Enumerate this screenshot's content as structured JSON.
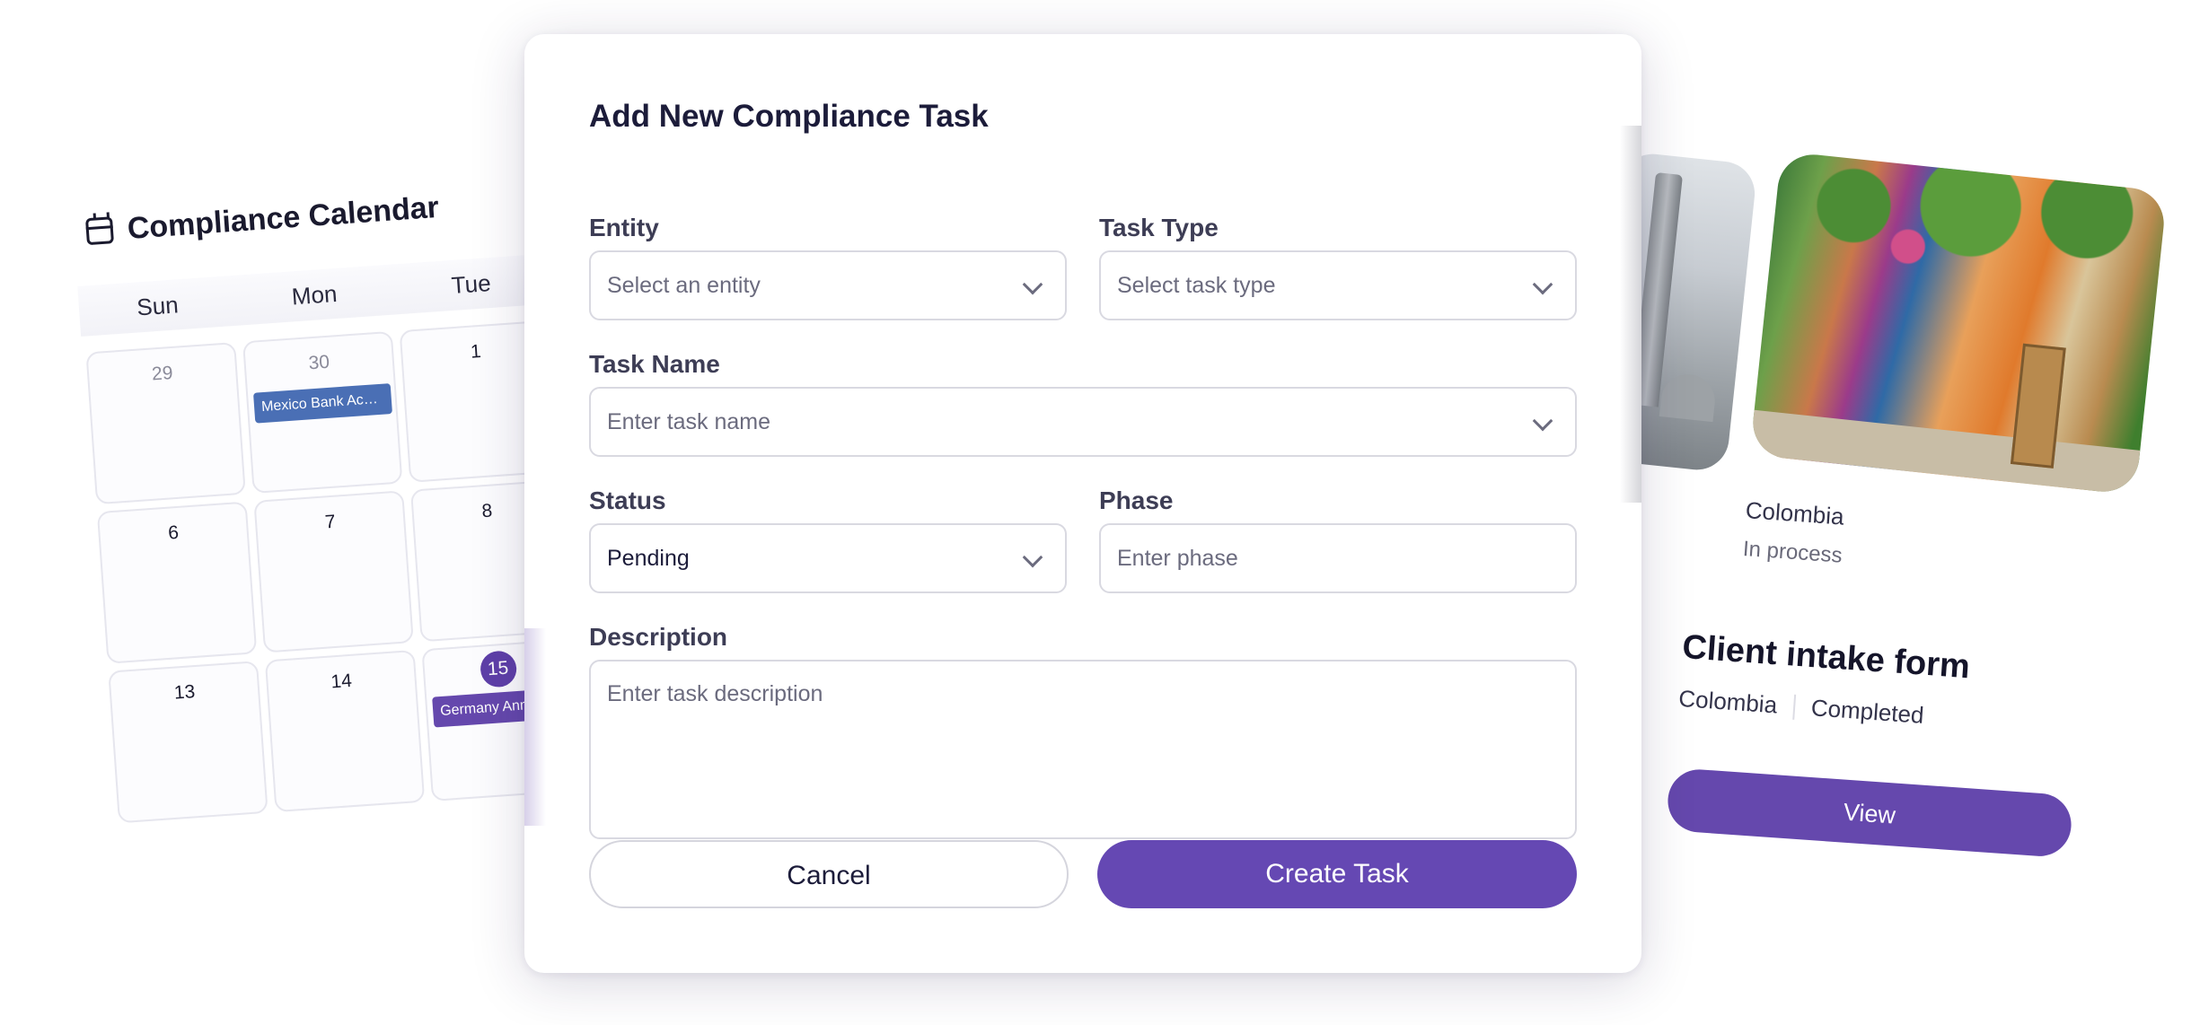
{
  "calendar": {
    "title": "Compliance Calendar",
    "weekdays": [
      "Sun",
      "Mon",
      "Tue"
    ],
    "days": [
      {
        "num": "29",
        "muted": true
      },
      {
        "num": "30",
        "muted": true,
        "event": "Mexico Bank Accou...",
        "event_color": "#4a6fb5"
      },
      {
        "num": "1"
      },
      {
        "num": "6"
      },
      {
        "num": "7"
      },
      {
        "num": "8"
      },
      {
        "num": "13"
      },
      {
        "num": "14"
      },
      {
        "num": "15",
        "today": true,
        "event": "Germany Annu...",
        "event_color": "#6548ad"
      }
    ]
  },
  "cards": {
    "place": "Colombia",
    "place_status": "In process",
    "intake_title": "Client intake form",
    "intake_country": "Colombia",
    "intake_status": "Completed",
    "view_label": "View"
  },
  "modal": {
    "title": "Add New Compliance Task",
    "entity": {
      "label": "Entity",
      "placeholder": "Select an entity"
    },
    "task_type": {
      "label": "Task Type",
      "placeholder": "Select task type"
    },
    "task_name": {
      "label": "Task Name",
      "placeholder": "Enter task name"
    },
    "status": {
      "label": "Status",
      "value": "Pending"
    },
    "phase": {
      "label": "Phase",
      "placeholder": "Enter phase"
    },
    "description": {
      "label": "Description",
      "placeholder": "Enter task description"
    },
    "cancel_label": "Cancel",
    "create_label": "Create Task"
  },
  "colors": {
    "accent": "#6548b3",
    "event_blue": "#4a6fb5"
  }
}
